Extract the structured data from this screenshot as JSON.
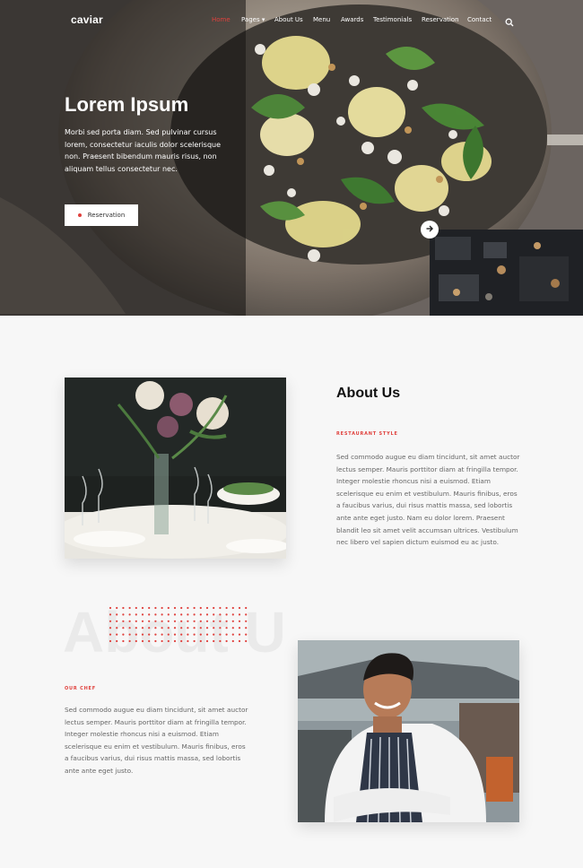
{
  "nav": {
    "logo": "caviar",
    "items": [
      {
        "label": "Home",
        "active": true
      },
      {
        "label": "Pages ▾",
        "active": false
      },
      {
        "label": "About Us",
        "active": false
      },
      {
        "label": "Menu",
        "active": false
      },
      {
        "label": "Awards",
        "active": false
      },
      {
        "label": "Testimonials",
        "active": false
      },
      {
        "label": "Reservation",
        "active": false
      },
      {
        "label": "Contact",
        "active": false
      }
    ],
    "search_icon": "search-icon"
  },
  "hero": {
    "title": "Lorem Ipsum",
    "text": "Morbi sed porta diam. Sed pulvinar cursus lorem, consectetur iaculis dolor scelerisque non. Praesent bibendum mauris risus, non aliquam tellus consectetur nec.",
    "button_label": "Reservation",
    "next_icon": "arrow-right-icon"
  },
  "about": {
    "title": "About Us",
    "eyebrow": "RESTAURANT STYLE",
    "text": "Sed commodo augue eu diam tincidunt, sit amet auctor lectus semper. Mauris porttitor diam at fringilla tempor. Integer molestie rhoncus nisi a euismod. Etiam scelerisque eu enim et vestibulum. Mauris finibus, eros a faucibus varius, dui risus mattis massa, sed lobortis ante ante eget justo. Nam eu dolor lorem. Praesent blandit leo sit amet velit accumsan ultrices. Vestibulum nec libero vel sapien dictum euismod eu ac justo."
  },
  "chef": {
    "watermark": "About U",
    "eyebrow": "OUR CHEF",
    "text": "Sed commodo augue eu diam tincidunt, sit amet auctor lectus semper. Mauris porttitor diam at fringilla tempor. Integer molestie rhoncus nisi a euismod. Etiam scelerisque eu enim et vestibulum. Mauris finibus, eros a faucibus varius, dui risus mattis massa, sed lobortis ante ante eget justo."
  },
  "colors": {
    "accent": "#e0413d",
    "text_dark": "#111111",
    "text_body": "#666666",
    "background": "#f7f7f7"
  }
}
